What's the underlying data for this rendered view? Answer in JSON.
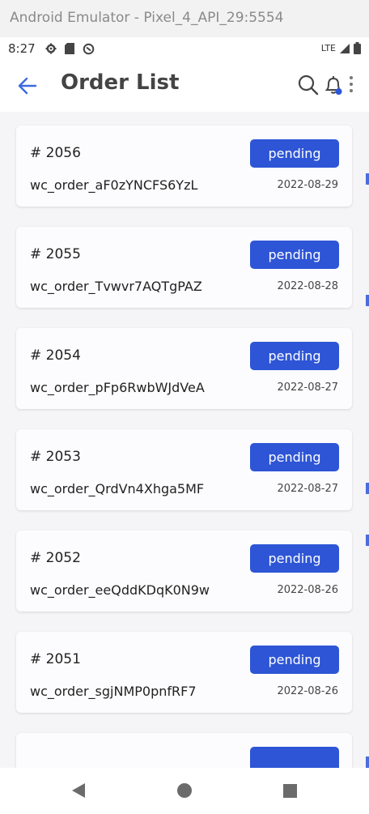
{
  "emulator": {
    "title": "Android Emulator - Pixel_4_API_29:5554"
  },
  "statusbar": {
    "time": "8:27",
    "network": "LTE",
    "left_icons": [
      "gear-icon",
      "sd-card-icon",
      "data-saver-icon"
    ],
    "right_icons": [
      "signal-icon",
      "battery-icon"
    ]
  },
  "appbar": {
    "title": "Order List",
    "back_icon": "arrow-left-icon",
    "actions": [
      "search-icon",
      "bell-icon",
      "more-vert-icon"
    ],
    "accent_color": "#2d55d6"
  },
  "orders": [
    {
      "number": "# 2056",
      "key": "wc_order_aF0zYNCFS6YzL",
      "status": "pending",
      "date": "2022-08-29"
    },
    {
      "number": "# 2055",
      "key": "wc_order_Tvwvr7AQTgPAZ",
      "status": "pending",
      "date": "2022-08-28"
    },
    {
      "number": "# 2054",
      "key": "wc_order_pFp6RwbWJdVeA",
      "status": "pending",
      "date": "2022-08-27"
    },
    {
      "number": "# 2053",
      "key": "wc_order_QrdVn4Xhga5MF",
      "status": "pending",
      "date": "2022-08-27"
    },
    {
      "number": "# 2052",
      "key": "wc_order_eeQddKDqK0N9w",
      "status": "pending",
      "date": "2022-08-26"
    },
    {
      "number": "# 2051",
      "key": "wc_order_sgjNMP0pnfRF7",
      "status": "pending",
      "date": "2022-08-26"
    },
    {
      "number": "",
      "key": "",
      "status": "",
      "date": ""
    }
  ],
  "colors": {
    "badge": "#2d55d6",
    "background": "#f5f5f7",
    "card": "#fcfcfe"
  },
  "navbar": {
    "icons": [
      "nav-back-icon",
      "nav-home-icon",
      "nav-recents-icon"
    ]
  }
}
